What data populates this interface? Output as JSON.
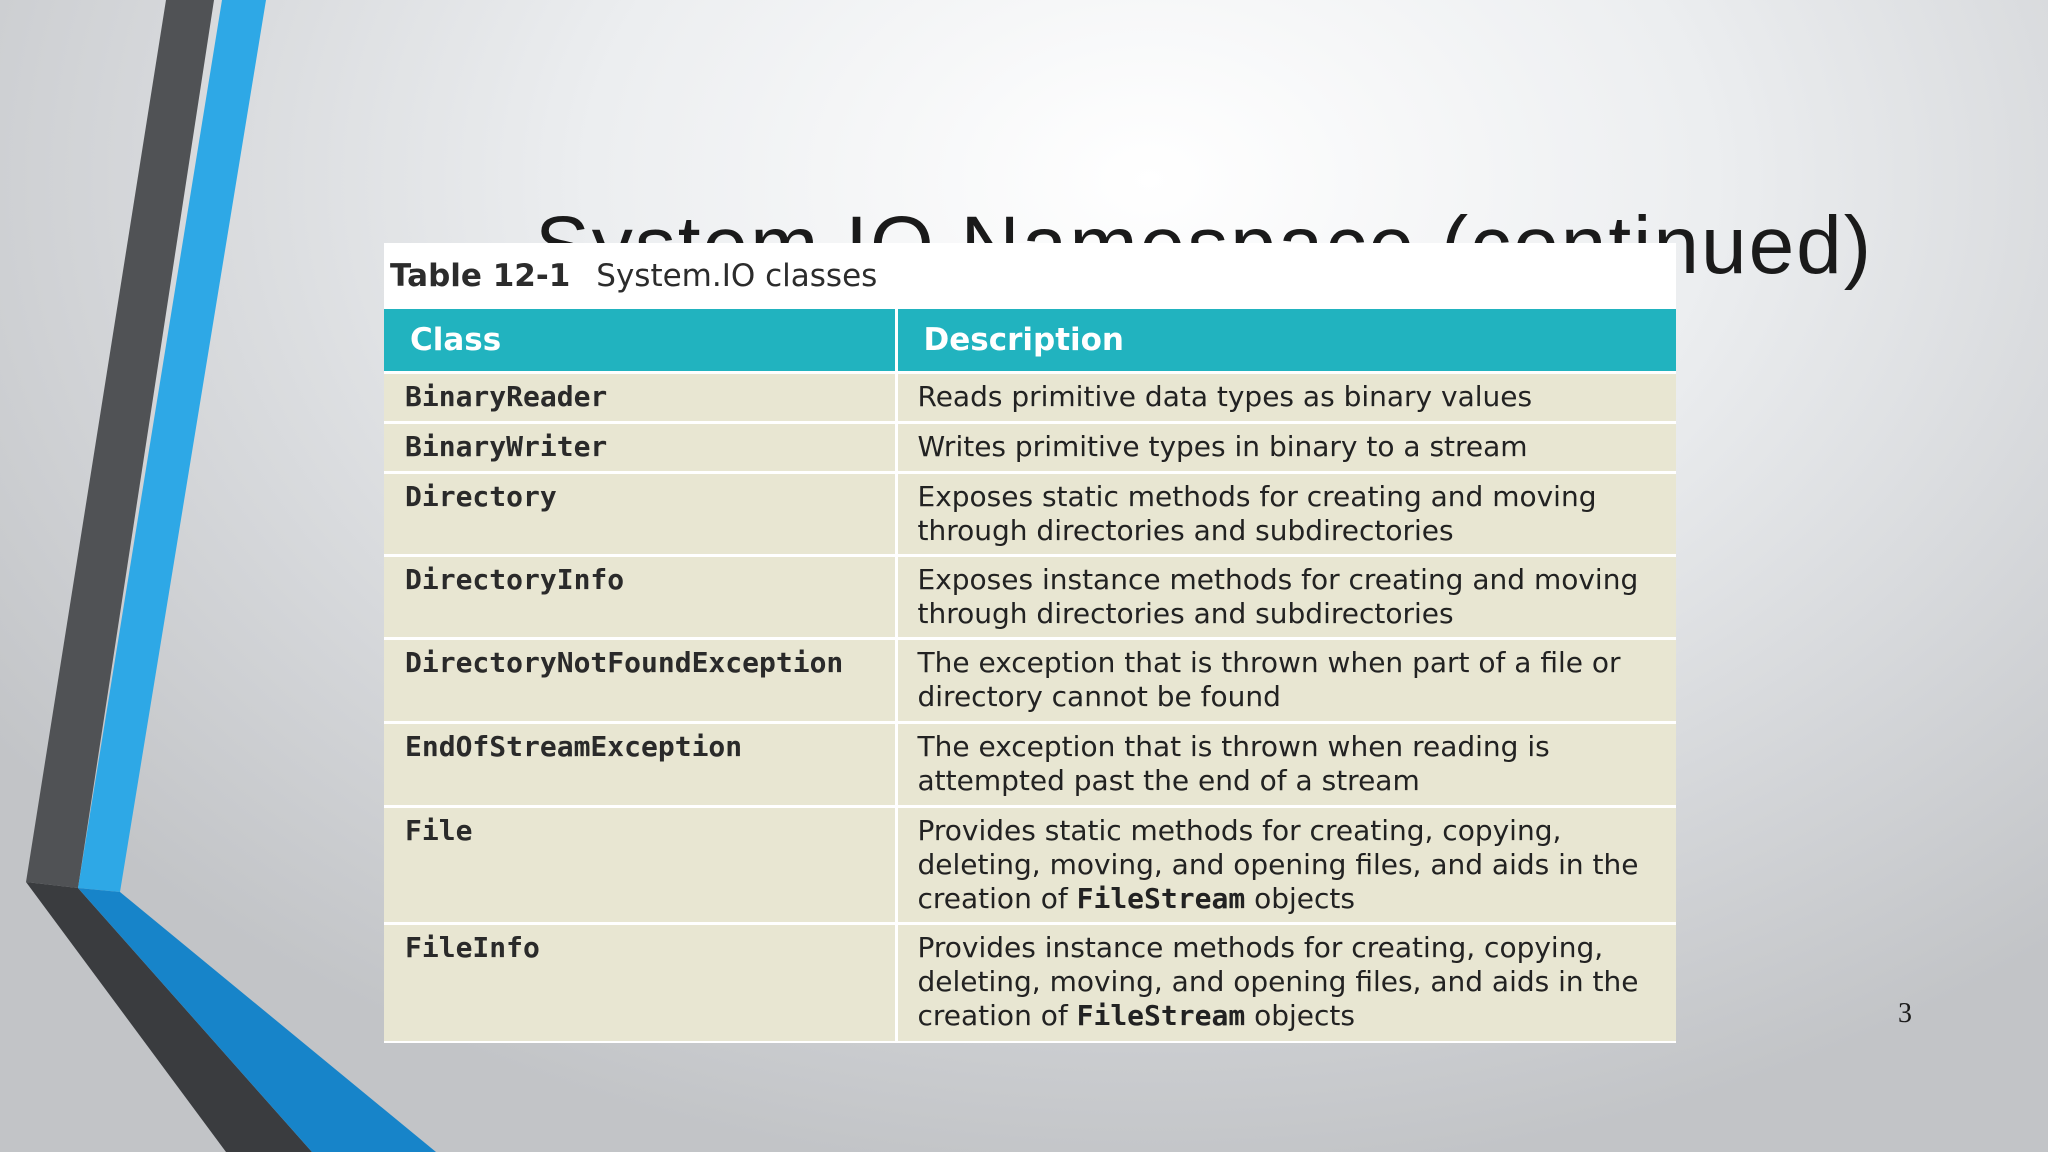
{
  "slide": {
    "title_visible_fragment": "System.IO Namespace (continued)",
    "page_number": "3"
  },
  "table": {
    "caption_number": "Table 12-1",
    "caption_text": "System.IO classes",
    "headers": [
      "Class",
      "Description"
    ],
    "rows": [
      {
        "class": "BinaryReader",
        "description": "Reads primitive data types as binary values"
      },
      {
        "class": "BinaryWriter",
        "description": "Writes primitive types in binary to a stream"
      },
      {
        "class": "Directory",
        "description": "Exposes static methods for creating and moving through directories and subdirectories"
      },
      {
        "class": "DirectoryInfo",
        "description": "Exposes instance methods for creating and moving through directories and subdirectories"
      },
      {
        "class": "DirectoryNotFoundException",
        "description": "The exception that is thrown when part of a file or directory cannot be found"
      },
      {
        "class": "EndOfStreamException",
        "description": "The exception that is thrown when reading is attempted past the end of a stream"
      },
      {
        "class": "File",
        "description": "Provides static methods for creating, copying, deleting, moving, and opening files, and aids in the creation of",
        "description_code": "FileStream",
        "description_tail": " objects"
      },
      {
        "class": "FileInfo",
        "description": "Provides instance methods for creating, copying, deleting, moving, and opening files, and aids in the creation of",
        "description_code": "FileStream",
        "description_tail": " objects"
      }
    ]
  },
  "colors": {
    "header_bg": "#21b3bf",
    "row_bg": "#e8e6d2",
    "accent_blue": "#2ea8e6",
    "accent_dark": "#4a4c4f"
  }
}
